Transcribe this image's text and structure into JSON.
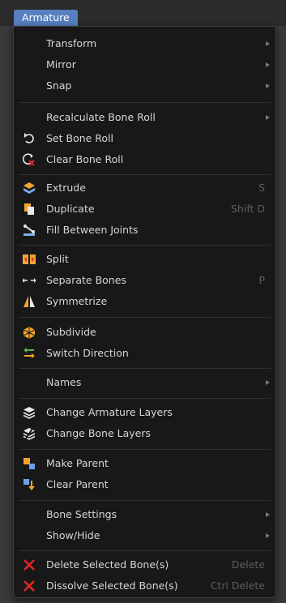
{
  "menu_title": "Armature",
  "items": [
    {
      "label": "Transform",
      "submenu": true
    },
    {
      "label": "Mirror",
      "submenu": true
    },
    {
      "label": "Snap",
      "submenu": true
    },
    {
      "label": "Recalculate Bone Roll",
      "submenu": true
    },
    {
      "label": "Set Bone Roll",
      "icon": "set-bone-roll-icon"
    },
    {
      "label": "Clear Bone Roll",
      "icon": "clear-bone-roll-icon"
    },
    {
      "label": "Extrude",
      "icon": "extrude-icon",
      "shortcut": "S"
    },
    {
      "label": "Duplicate",
      "icon": "duplicate-icon",
      "shortcut": "Shift D"
    },
    {
      "label": "Fill Between Joints",
      "icon": "fill-between-joints-icon"
    },
    {
      "label": "Split",
      "icon": "split-icon"
    },
    {
      "label": "Separate Bones",
      "icon": "separate-bones-icon",
      "shortcut": "P"
    },
    {
      "label": "Symmetrize",
      "icon": "symmetrize-icon"
    },
    {
      "label": "Subdivide",
      "icon": "subdivide-icon"
    },
    {
      "label": "Switch Direction",
      "icon": "switch-direction-icon"
    },
    {
      "label": "Names",
      "submenu": true
    },
    {
      "label": "Change Armature Layers",
      "icon": "armature-layers-icon"
    },
    {
      "label": "Change Bone Layers",
      "icon": "bone-layers-icon"
    },
    {
      "label": "Make Parent",
      "icon": "make-parent-icon"
    },
    {
      "label": "Clear Parent",
      "icon": "clear-parent-icon"
    },
    {
      "label": "Bone Settings",
      "submenu": true
    },
    {
      "label": "Show/Hide",
      "submenu": true
    },
    {
      "label": "Delete Selected Bone(s)",
      "icon": "delete-x-icon",
      "shortcut": "Delete"
    },
    {
      "label": "Dissolve Selected Bone(s)",
      "icon": "dissolve-x-icon",
      "shortcut": "Ctrl Delete"
    }
  ],
  "colors": {
    "menu_background": "#181818",
    "title_tab": "#5680c2",
    "text": "#d6d6d6",
    "shortcut_text": "#5e5e5e",
    "delete_icon": "#e0252b"
  }
}
